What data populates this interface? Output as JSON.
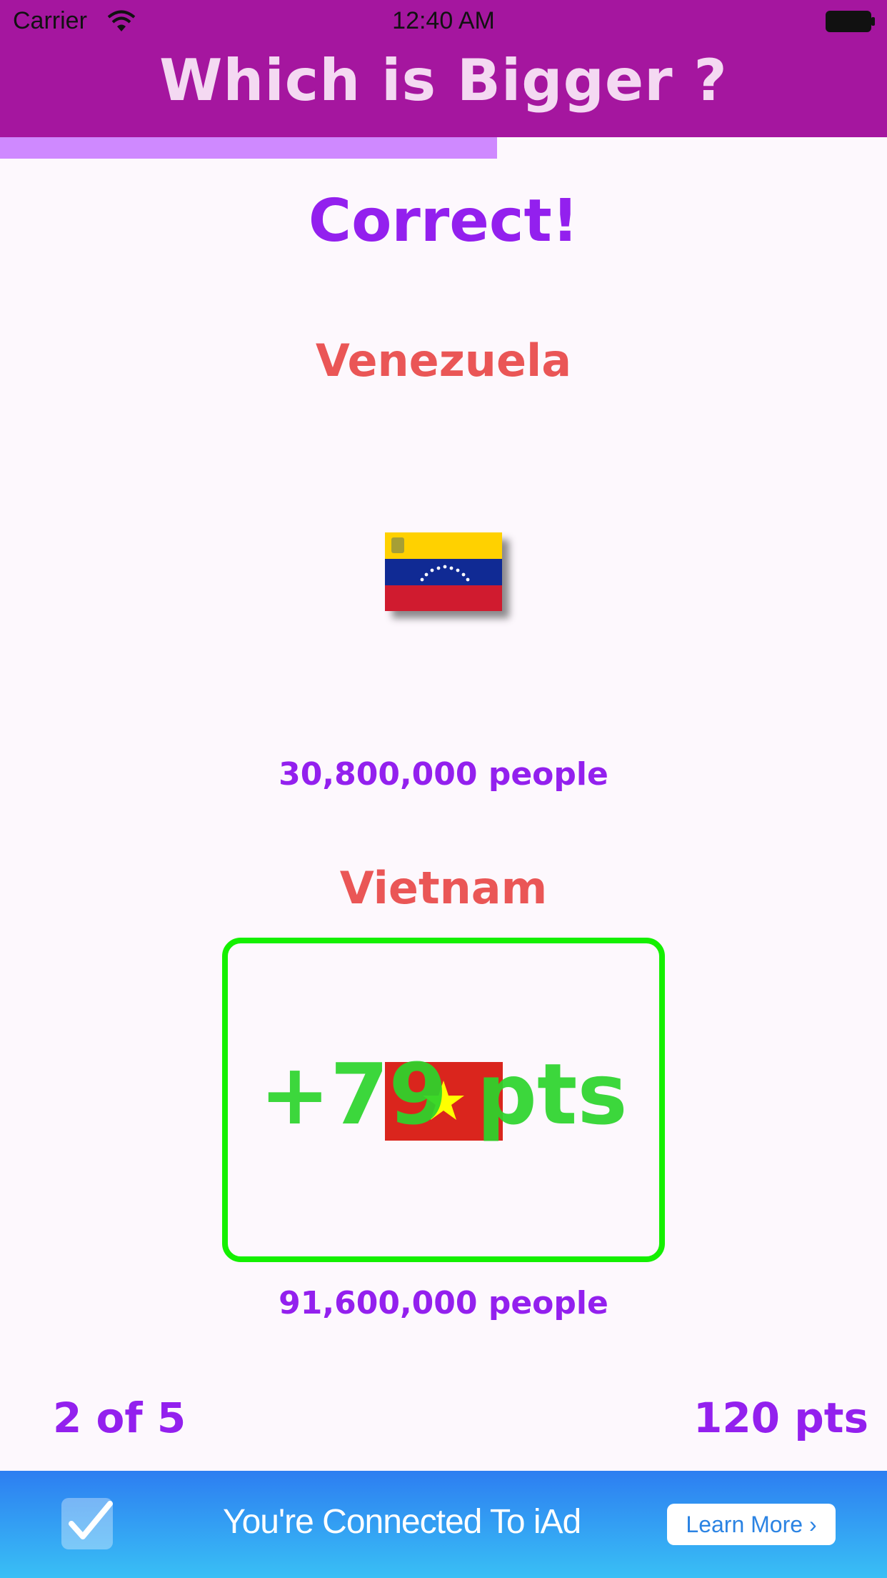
{
  "status_bar": {
    "carrier": "Carrier",
    "time": "12:40 AM"
  },
  "header": {
    "title": "Which is Bigger ?"
  },
  "progress": {
    "fraction": 0.56
  },
  "result": {
    "text": "Correct!"
  },
  "countries": [
    {
      "name": "Venezuela",
      "population": "30,800,000 people",
      "flag_icon": "venezuela-flag-icon"
    },
    {
      "name": "Vietnam",
      "population": "91,600,000 people",
      "flag_icon": "vietnam-flag-icon",
      "points_awarded": "+79 pts"
    }
  ],
  "footer": {
    "question_counter": "2 of 5",
    "score": "120 pts"
  },
  "ad": {
    "text": "You're Connected To iAd",
    "button_label": "Learn More",
    "button_chevron": "›"
  },
  "colors": {
    "header": "#a5169f",
    "title": "#f4d9f2",
    "accent": "#9320ee",
    "country_name": "#ea5656",
    "correct_border": "#14f000",
    "points": "#2cd52c",
    "progress": "#cf89ff"
  }
}
